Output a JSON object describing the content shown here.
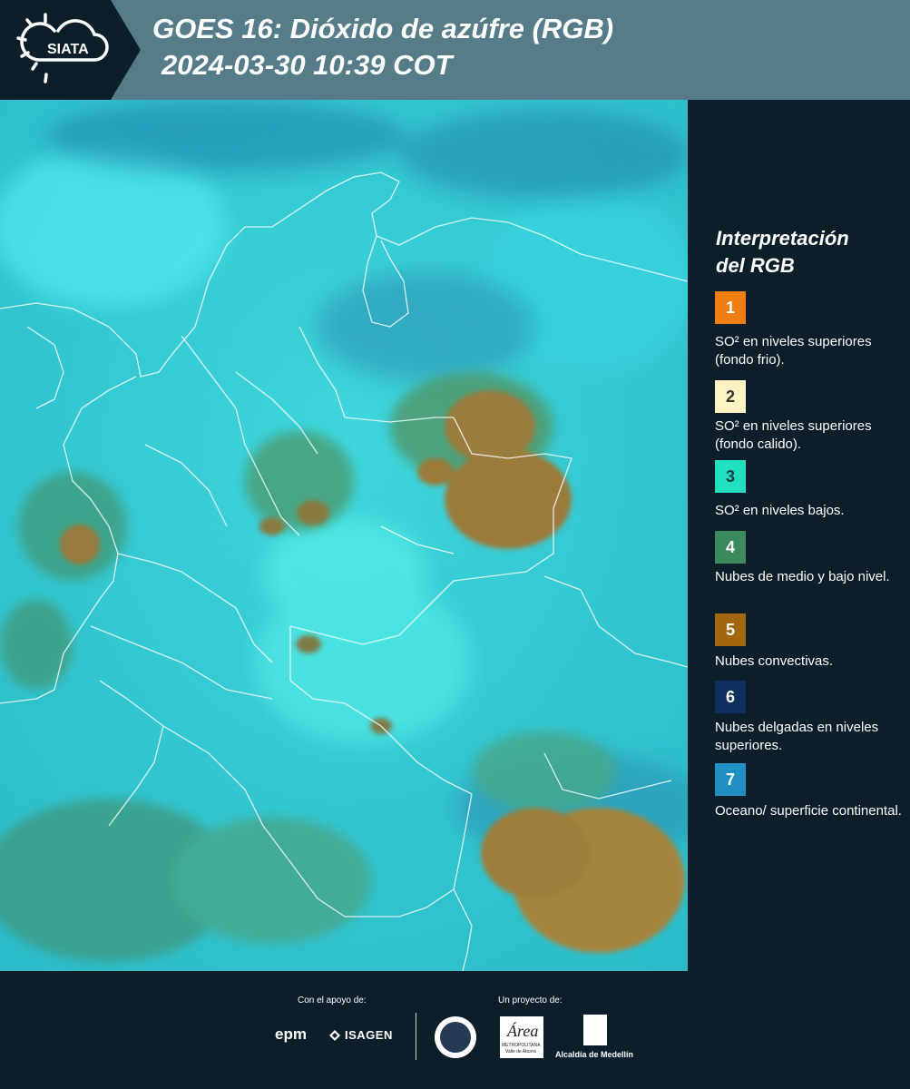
{
  "header": {
    "logo_text": "SIATA",
    "title_line1": "GOES 16: Dióxido de azúfre (RGB)",
    "title_line2": "2024-03-30 10:39 COT"
  },
  "legend": {
    "title_line1": "Interpretación",
    "title_line2": "del RGB",
    "items": [
      {
        "number": "1",
        "color": "#f27d12",
        "text_color": "#ffffff",
        "label": "SO² en niveles superiores (fondo frio)."
      },
      {
        "number": "2",
        "color": "#fcf3c2",
        "text_color": "#333333",
        "label": "SO² en niveles superiores (fondo calido)."
      },
      {
        "number": "3",
        "color": "#22dfc0",
        "text_color": "#1b3d44",
        "label": "SO² en niveles bajos."
      },
      {
        "number": "4",
        "color": "#3b8b5f",
        "text_color": "#ffffff",
        "label": "Nubes de medio y bajo nivel."
      },
      {
        "number": "5",
        "color": "#a3680f",
        "text_color": "#ffffff",
        "label": "Nubes convectivas."
      },
      {
        "number": "6",
        "color": "#0f2f5c",
        "text_color": "#ffffff",
        "label": "Nubes delgadas en niveles superiores."
      },
      {
        "number": "7",
        "color": "#1f8fc4",
        "text_color": "#ffffff",
        "label": "Oceano/ superficie continental."
      }
    ]
  },
  "footer": {
    "support_label": "Con el apoyo de:",
    "project_label": "Un proyecto de:",
    "epm": "epm",
    "isagen": "ISAGEN",
    "area_line1": "Área",
    "area_line2": "METROPOLITANA",
    "area_line3": "Valle de Aburrá",
    "alcaldia": "Alcaldía de Medellín"
  }
}
